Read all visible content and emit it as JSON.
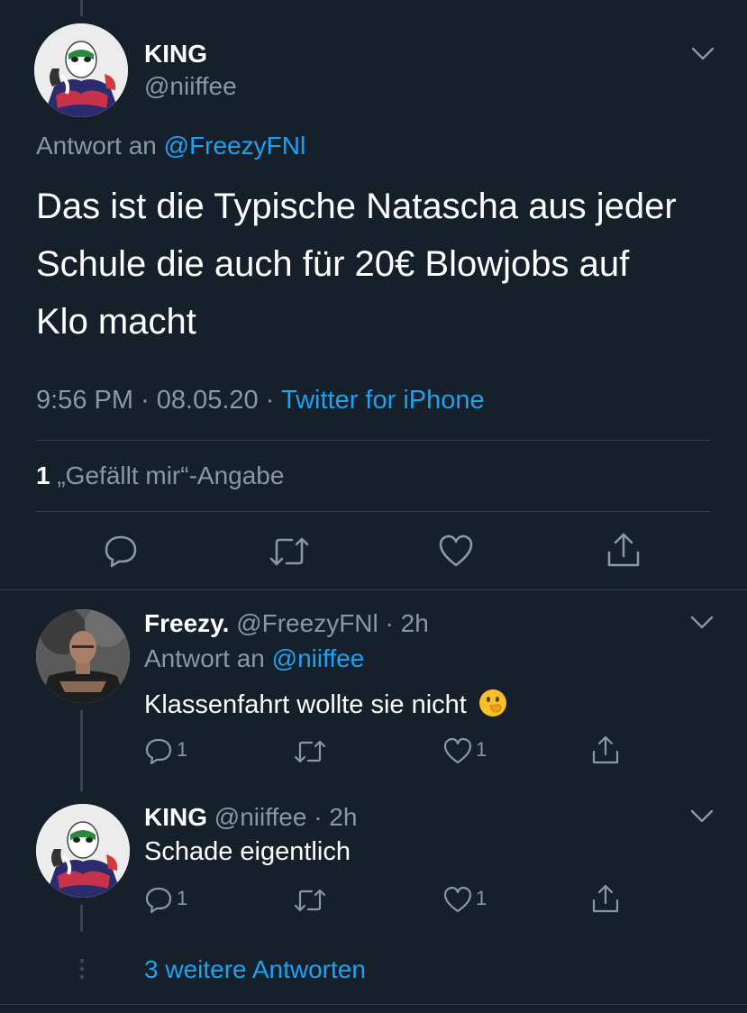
{
  "main_tweet": {
    "display_name": "KING",
    "handle": "@niiffee",
    "reply_prefix": "Antwort an",
    "reply_to": "@FreezyFNl",
    "text_line1": "Das ist die Typische Natascha aus jeder",
    "text_line2": "Schule die auch für 20€ Blowjobs auf",
    "text_line3": "Klo macht",
    "time": "9:56 PM",
    "date": "08.05.20",
    "separator": "·",
    "source": "Twitter for iPhone",
    "likes_count": "1",
    "likes_label": "„Gefällt mir“-Angabe"
  },
  "reply1": {
    "display_name": "Freezy.",
    "handle_time": "@FreezyFNl · 2h",
    "reply_prefix": "Antwort an",
    "reply_to": "@niiffee",
    "text": "Klassenfahrt wollte sie nicht",
    "emoji": "🫢",
    "reply_count": "1",
    "like_count": "1"
  },
  "reply2": {
    "display_name": "KING",
    "handle_time": "@niiffee · 2h",
    "text": "Schade eigentlich",
    "reply_count": "1",
    "like_count": "1"
  },
  "more_replies": "3 weitere Antworten",
  "colors": {
    "background": "#15202b",
    "text": "#ffffff",
    "muted": "#8899a6",
    "link": "#1da1f2",
    "border": "#38444d"
  }
}
